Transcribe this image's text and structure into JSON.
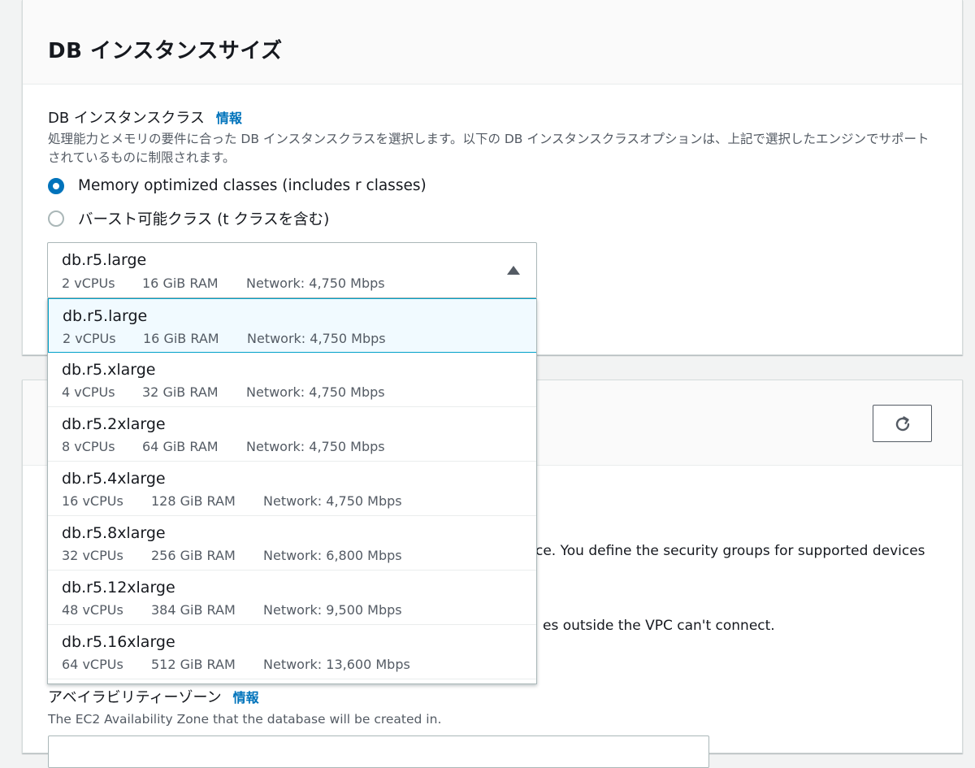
{
  "panel1": {
    "title": "DB インスタンスサイズ",
    "field_label": "DB インスタンスクラス",
    "info_link": "情報",
    "description": "処理能力とメモリの要件に合った DB インスタンスクラスを選択します。以下の DB インスタンスクラスオプションは、上記で選択したエンジンでサポートされているものに制限されます。",
    "radio_options": [
      {
        "label": "Memory optimized classes (includes r classes)",
        "checked": true
      },
      {
        "label": "バースト可能クラス (t クラスを含む)",
        "checked": false
      }
    ],
    "select": {
      "name": "db.r5.large",
      "vcpus": "2 vCPUs",
      "ram": "16 GiB RAM",
      "network": "Network: 4,750 Mbps"
    }
  },
  "dropdown": {
    "items": [
      {
        "name": "db.r5.large",
        "vcpus": "2 vCPUs",
        "ram": "16 GiB RAM",
        "network": "Network: 4,750 Mbps"
      },
      {
        "name": "db.r5.xlarge",
        "vcpus": "4 vCPUs",
        "ram": "32 GiB RAM",
        "network": "Network: 4,750 Mbps"
      },
      {
        "name": "db.r5.2xlarge",
        "vcpus": "8 vCPUs",
        "ram": "64 GiB RAM",
        "network": "Network: 4,750 Mbps"
      },
      {
        "name": "db.r5.4xlarge",
        "vcpus": "16 vCPUs",
        "ram": "128 GiB RAM",
        "network": "Network: 4,750 Mbps"
      },
      {
        "name": "db.r5.8xlarge",
        "vcpus": "32 vCPUs",
        "ram": "256 GiB RAM",
        "network": "Network: 6,800 Mbps"
      },
      {
        "name": "db.r5.12xlarge",
        "vcpus": "48 vCPUs",
        "ram": "384 GiB RAM",
        "network": "Network: 9,500 Mbps"
      },
      {
        "name": "db.r5.16xlarge",
        "vcpus": "64 vCPUs",
        "ram": "512 GiB RAM",
        "network": "Network: 13,600 Mbps"
      }
    ]
  },
  "panel2": {
    "partial_text_1": "ce. You define the security groups for supported devices",
    "partial_text_2": "es outside the VPC can't connect.",
    "az_label": "アベイラビリティーゾーン",
    "az_info_link": "情報",
    "az_description": "The EC2 Availability Zone that the database will be created in."
  },
  "icons": {
    "refresh": "refresh-icon",
    "caret": "caret-up-icon"
  },
  "colors": {
    "link": "#0073bb",
    "selected_border": "#00a1c9",
    "selected_bg": "#f1faff"
  }
}
